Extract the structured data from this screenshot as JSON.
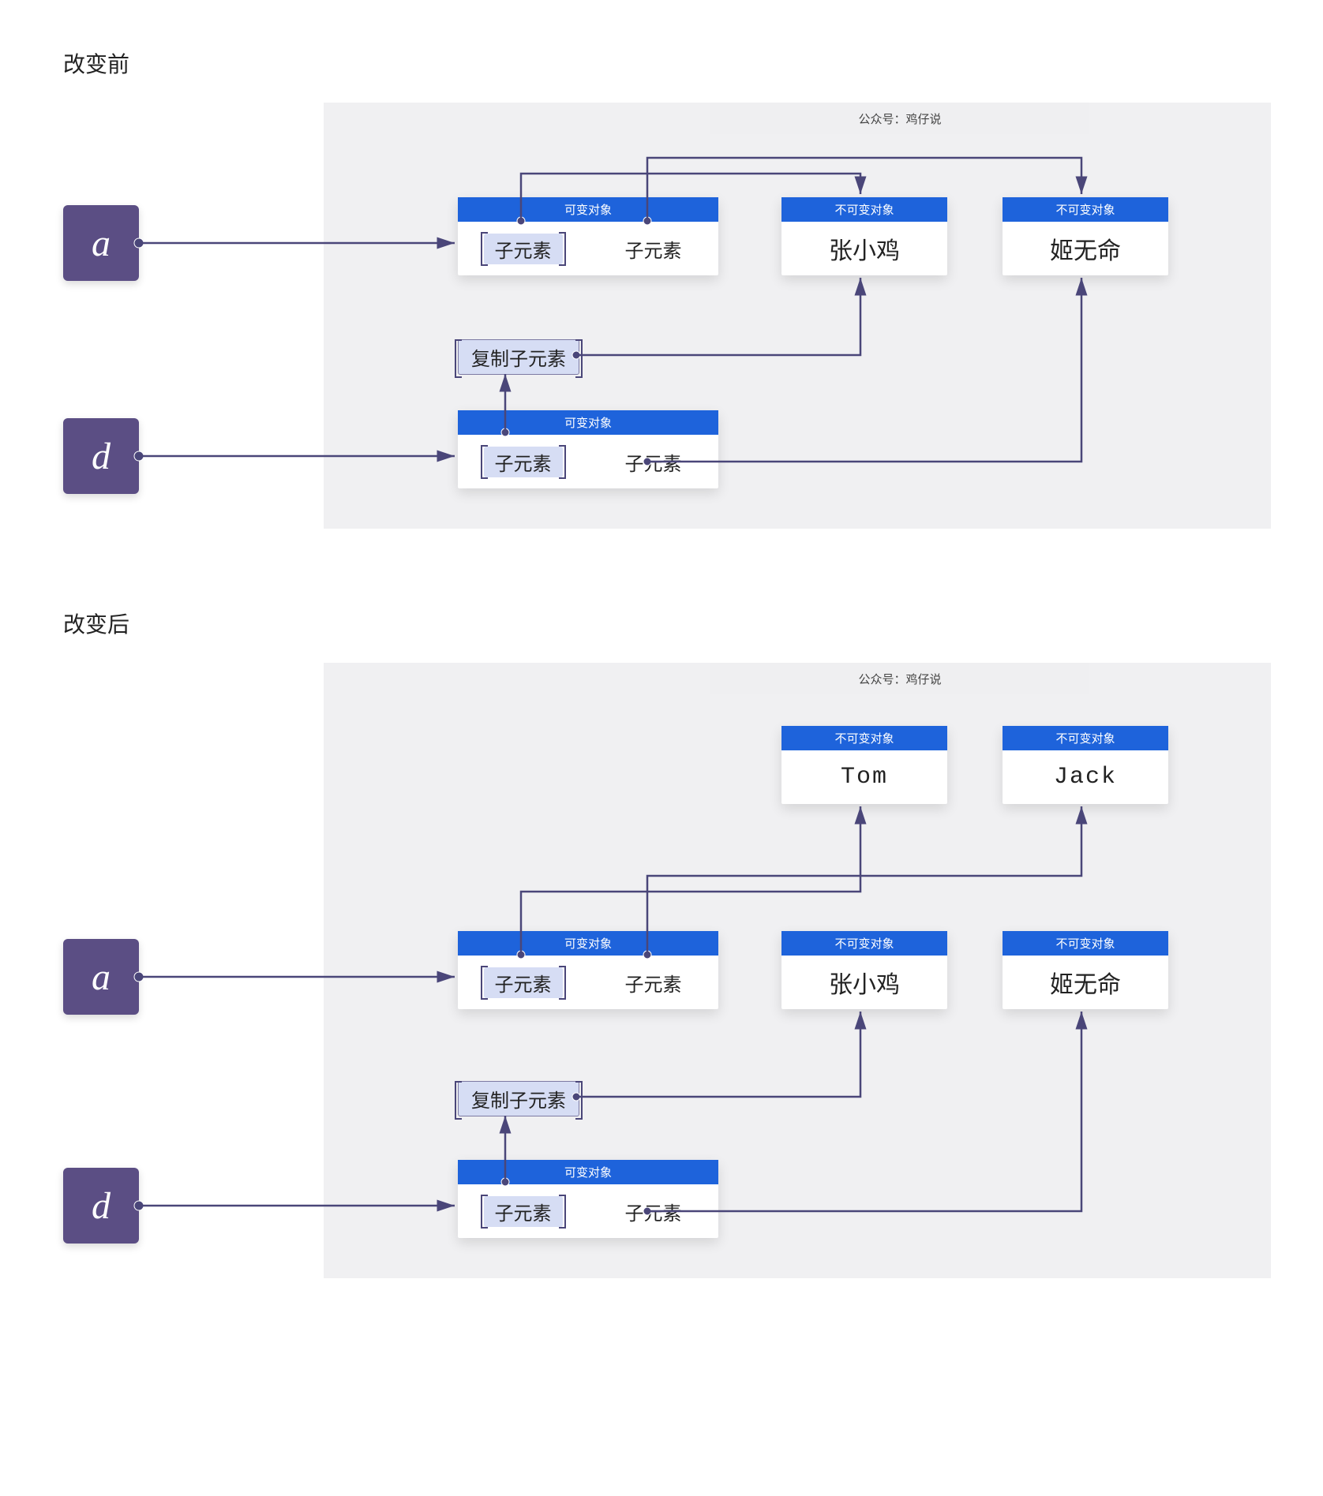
{
  "section1": {
    "title": "改变前",
    "watermark": "公众号：鸡仔说",
    "var_a": "a",
    "var_d": "d",
    "mutable_label": "可变对象",
    "immutable_label": "不可变对象",
    "child_label": "子元素",
    "copy_child_label": "复制子元素",
    "name1": "张小鸡",
    "name2": "姬无命"
  },
  "section2": {
    "title": "改变后",
    "watermark": "公众号：鸡仔说",
    "var_a": "a",
    "var_d": "d",
    "mutable_label": "可变对象",
    "immutable_label": "不可变对象",
    "child_label": "子元素",
    "copy_child_label": "复制子元素",
    "name1": "张小鸡",
    "name2": "姬无命",
    "new1": "Tom",
    "new2": "Jack"
  },
  "colors": {
    "var_box": "#5b4e84",
    "header": "#1e63db",
    "chip_bg": "#d6ddf4",
    "line": "#4a4679",
    "canvas": "#f0f0f2"
  }
}
